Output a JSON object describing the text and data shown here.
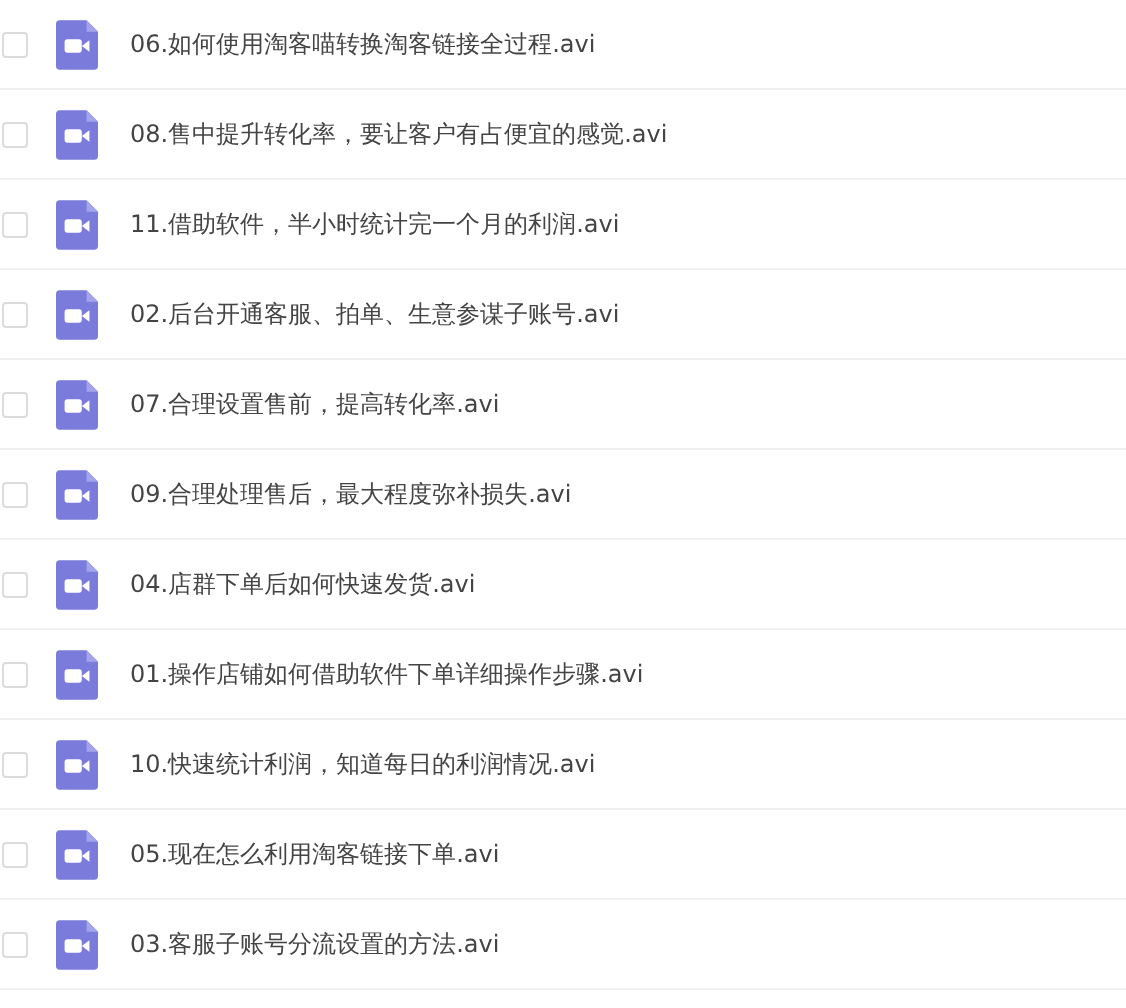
{
  "files": [
    {
      "name": "06.如何使用淘客喵转换淘客链接全过程.avi",
      "checked": false
    },
    {
      "name": "08.售中提升转化率，要让客户有占便宜的感觉.avi",
      "checked": false
    },
    {
      "name": "11.借助软件，半小时统计完一个月的利润.avi",
      "checked": false
    },
    {
      "name": "02.后台开通客服、拍单、生意参谋子账号.avi",
      "checked": false
    },
    {
      "name": "07.合理设置售前，提高转化率.avi",
      "checked": false
    },
    {
      "name": "09.合理处理售后，最大程度弥补损失.avi",
      "checked": false
    },
    {
      "name": "04.店群下单后如何快速发货.avi",
      "checked": false
    },
    {
      "name": "01.操作店铺如何借助软件下单详细操作步骤.avi",
      "checked": false
    },
    {
      "name": "10.快速统计利润，知道每日的利润情况.avi",
      "checked": false
    },
    {
      "name": "05.现在怎么利用淘客链接下单.avi",
      "checked": false
    },
    {
      "name": "03.客服子账号分流设置的方法.avi",
      "checked": false
    }
  ]
}
